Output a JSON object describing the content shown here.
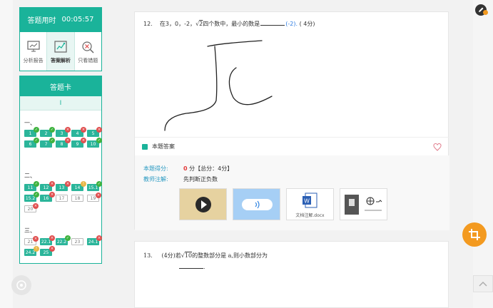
{
  "timer": {
    "label": "答题用时",
    "value": "00:05:57"
  },
  "tools": [
    {
      "label": "分析报告",
      "icon": "report-icon"
    },
    {
      "label": "答案解析",
      "icon": "analysis-icon",
      "active": true
    },
    {
      "label": "只看错题",
      "icon": "wrong-only-icon"
    }
  ],
  "answer_card": {
    "title": "答题卡",
    "roman": "I",
    "sections": [
      {
        "label": "一、",
        "items": [
          {
            "n": "1",
            "mark": "ok"
          },
          {
            "n": "2",
            "mark": "ok"
          },
          {
            "n": "3",
            "mark": "bad"
          },
          {
            "n": "4",
            "mark": "bad"
          },
          {
            "n": "5",
            "mark": "bad"
          },
          {
            "n": "6",
            "mark": "ok"
          },
          {
            "n": "7",
            "mark": "ok"
          },
          {
            "n": "8",
            "mark": "bad"
          },
          {
            "n": "9",
            "mark": "bad"
          },
          {
            "n": "10",
            "mark": "ok"
          }
        ]
      },
      {
        "label": "二、",
        "items": [
          {
            "n": "11",
            "mark": "ok"
          },
          {
            "n": "12",
            "mark": "bad"
          },
          {
            "n": "13",
            "mark": "bad"
          },
          {
            "n": "14",
            "mark": "half"
          },
          {
            "n": "15.1",
            "mark": "ok"
          },
          {
            "n": "15.2",
            "mark": "ok"
          },
          {
            "n": "16",
            "mark": "bad"
          },
          {
            "n": "17",
            "mark": "none",
            "style": "w"
          },
          {
            "n": "18",
            "mark": "none",
            "style": "w"
          },
          {
            "n": "19",
            "mark": "bad",
            "style": "w"
          },
          {
            "n": "20",
            "mark": "bad",
            "style": "w"
          }
        ]
      },
      {
        "label": "三、",
        "items": [
          {
            "n": "21",
            "mark": "bad",
            "style": "w"
          },
          {
            "n": "22.1",
            "mark": "bad"
          },
          {
            "n": "22.2",
            "mark": "ok"
          },
          {
            "n": "23",
            "mark": "none",
            "style": "w"
          },
          {
            "n": "24.1",
            "mark": "bad"
          },
          {
            "n": "24.2",
            "mark": "half"
          },
          {
            "n": "25",
            "mark": "bad"
          }
        ]
      }
    ]
  },
  "q12": {
    "number": "12.",
    "text_before": "在3，0，-2，",
    "sqrt": "2",
    "text_after": "四个数中，最小的数是",
    "answer": "(-2).",
    "points": "( 4分)",
    "this_answer_label": "本题答案",
    "score_label": "本题得分:",
    "score_value": "0",
    "score_unit": "分【总分：4分】",
    "teacher_label": "教师注解:",
    "teacher_note": "先判断正负数",
    "attachments": [
      {
        "type": "video",
        "icon": "play-icon"
      },
      {
        "type": "audio",
        "icon": "audio-icon"
      },
      {
        "type": "doc",
        "icon": "word-icon",
        "caption": "文档注解.docx"
      },
      {
        "type": "image",
        "icon": "image-icon"
      }
    ]
  },
  "q13": {
    "number": "13.",
    "text": "(4分)若",
    "sqrt": "10",
    "text_after": "的整数部分是 a,则小数部分为",
    "end": "."
  }
}
